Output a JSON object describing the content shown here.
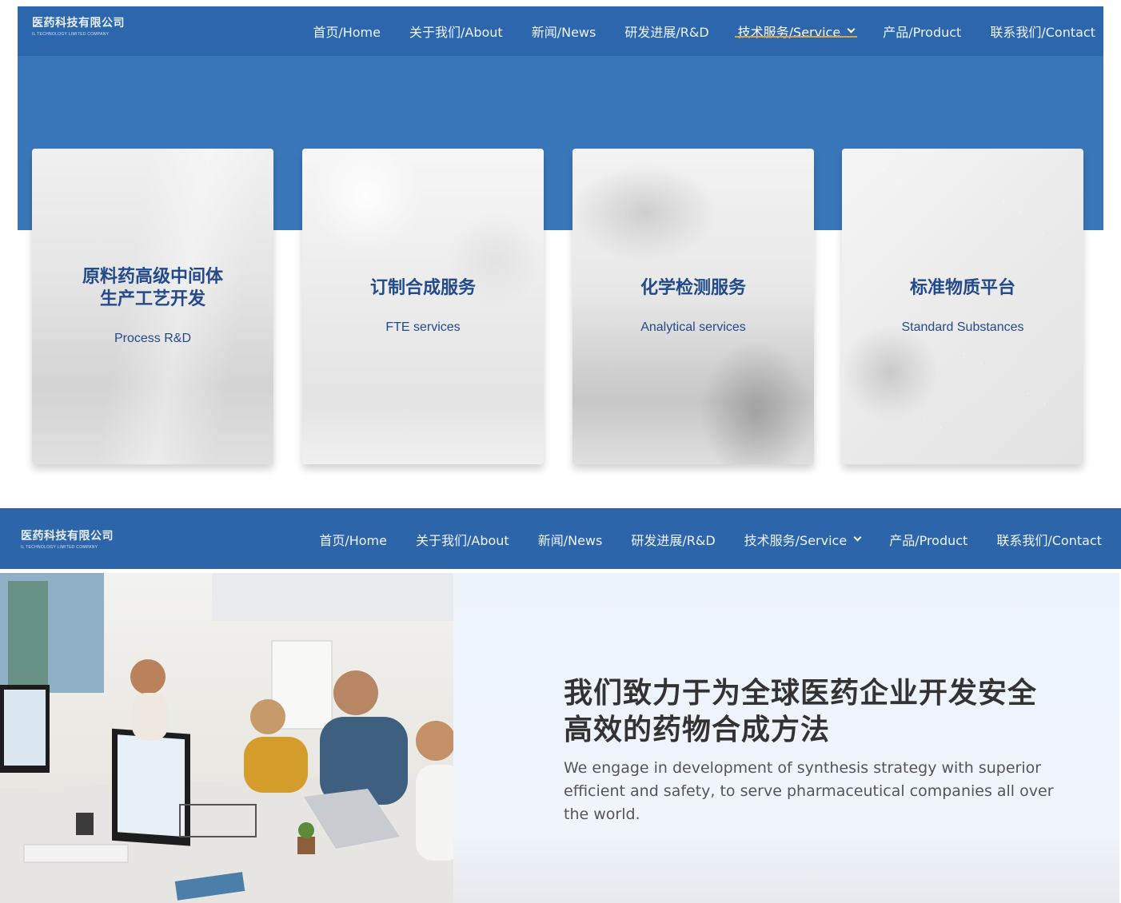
{
  "brand": {
    "name_cn": "医药科技有限公司",
    "name_en": "IL TECHNOLOGY LIMITED COMPANY"
  },
  "nav": {
    "items": [
      {
        "label": "首页/Home",
        "active": false
      },
      {
        "label": "关于我们/About",
        "active": false
      },
      {
        "label": "新闻/News",
        "active": false
      },
      {
        "label": "研发进展/R&D",
        "active": false
      },
      {
        "label": "技术服务/Service",
        "active": true,
        "has_dropdown": true
      },
      {
        "label": "产品/Product",
        "active": false
      },
      {
        "label": "联系我们/Contact",
        "active": false
      }
    ]
  },
  "services": [
    {
      "title": "原料药高级中间体生产工艺开发",
      "title_line1": "原料药高级中间体",
      "title_line2": "生产工艺开发",
      "subtitle": "Process R&D",
      "icon": "pipette-vials-photo"
    },
    {
      "title": "订制合成服务",
      "subtitle": "FTE services",
      "icon": "lab-scientist-photo"
    },
    {
      "title": "化学检测服务",
      "subtitle": "Analytical services",
      "icon": "sample-rack-photo"
    },
    {
      "title": "标准物质平台",
      "subtitle": "Standard Substances",
      "icon": "molecule-pattern-photo"
    }
  ],
  "intro": {
    "heading": "我们致力于为全球医药企业开发安全高效的药物合成方法",
    "heading_line1": "我们致力于为全球医药企业开发安全",
    "heading_line2": "高效的药物合成方法",
    "description": "We engage in development of synthesis strategy with superior efficient and safety, to serve pharmaceutical companies all over the world.",
    "image": "office-team-photo"
  },
  "colors": {
    "nav_bg": "#2c66ad",
    "hero_bg": "#3a77ba",
    "active_underline": "#e8a13a",
    "card_title": "#234a8a"
  }
}
